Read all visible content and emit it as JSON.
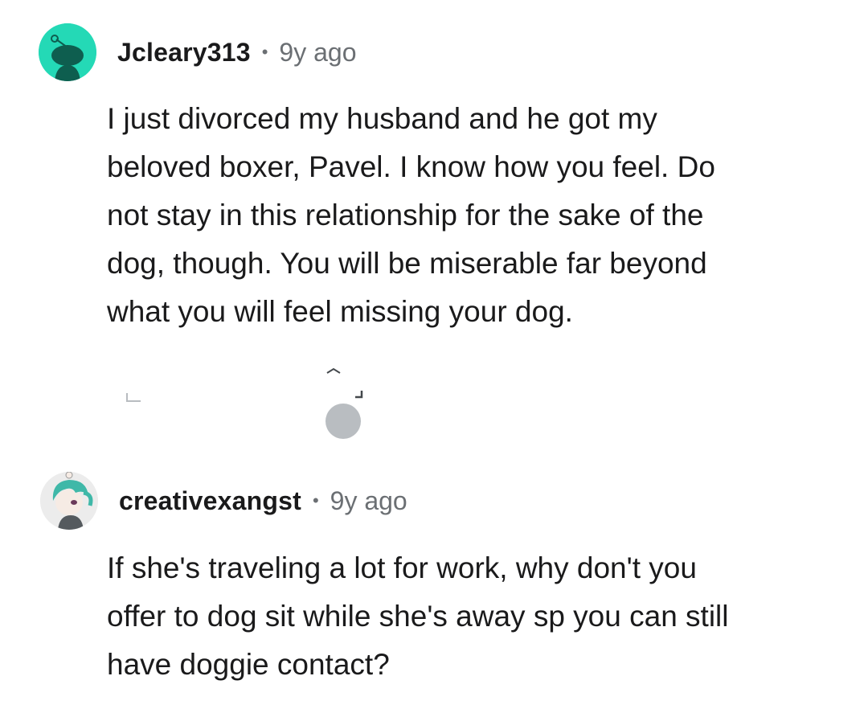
{
  "comments": [
    {
      "username": "Jcleary313",
      "separator": "•",
      "time": "9y ago",
      "lines": [
        "I just divorced my husband and he got my",
        "beloved boxer, Pavel. I know how you feel. Do",
        "not stay in this relationship for the sake of the",
        "dog, though. You will be miserable far beyond",
        "what you will feel missing your dog."
      ],
      "avatar_icon": "snoo-avatar-icon",
      "avatar_color": "#24d9b6"
    },
    {
      "username": "creativexangst",
      "separator": "•",
      "time": "9y ago",
      "lines": [
        "If she's traveling a lot for work, why don't you",
        "offer to dog sit while she's away sp you can still",
        "have doggie contact?"
      ],
      "avatar_icon": "custom-avatar-icon",
      "avatar_color": "#3fb8a8"
    }
  ]
}
